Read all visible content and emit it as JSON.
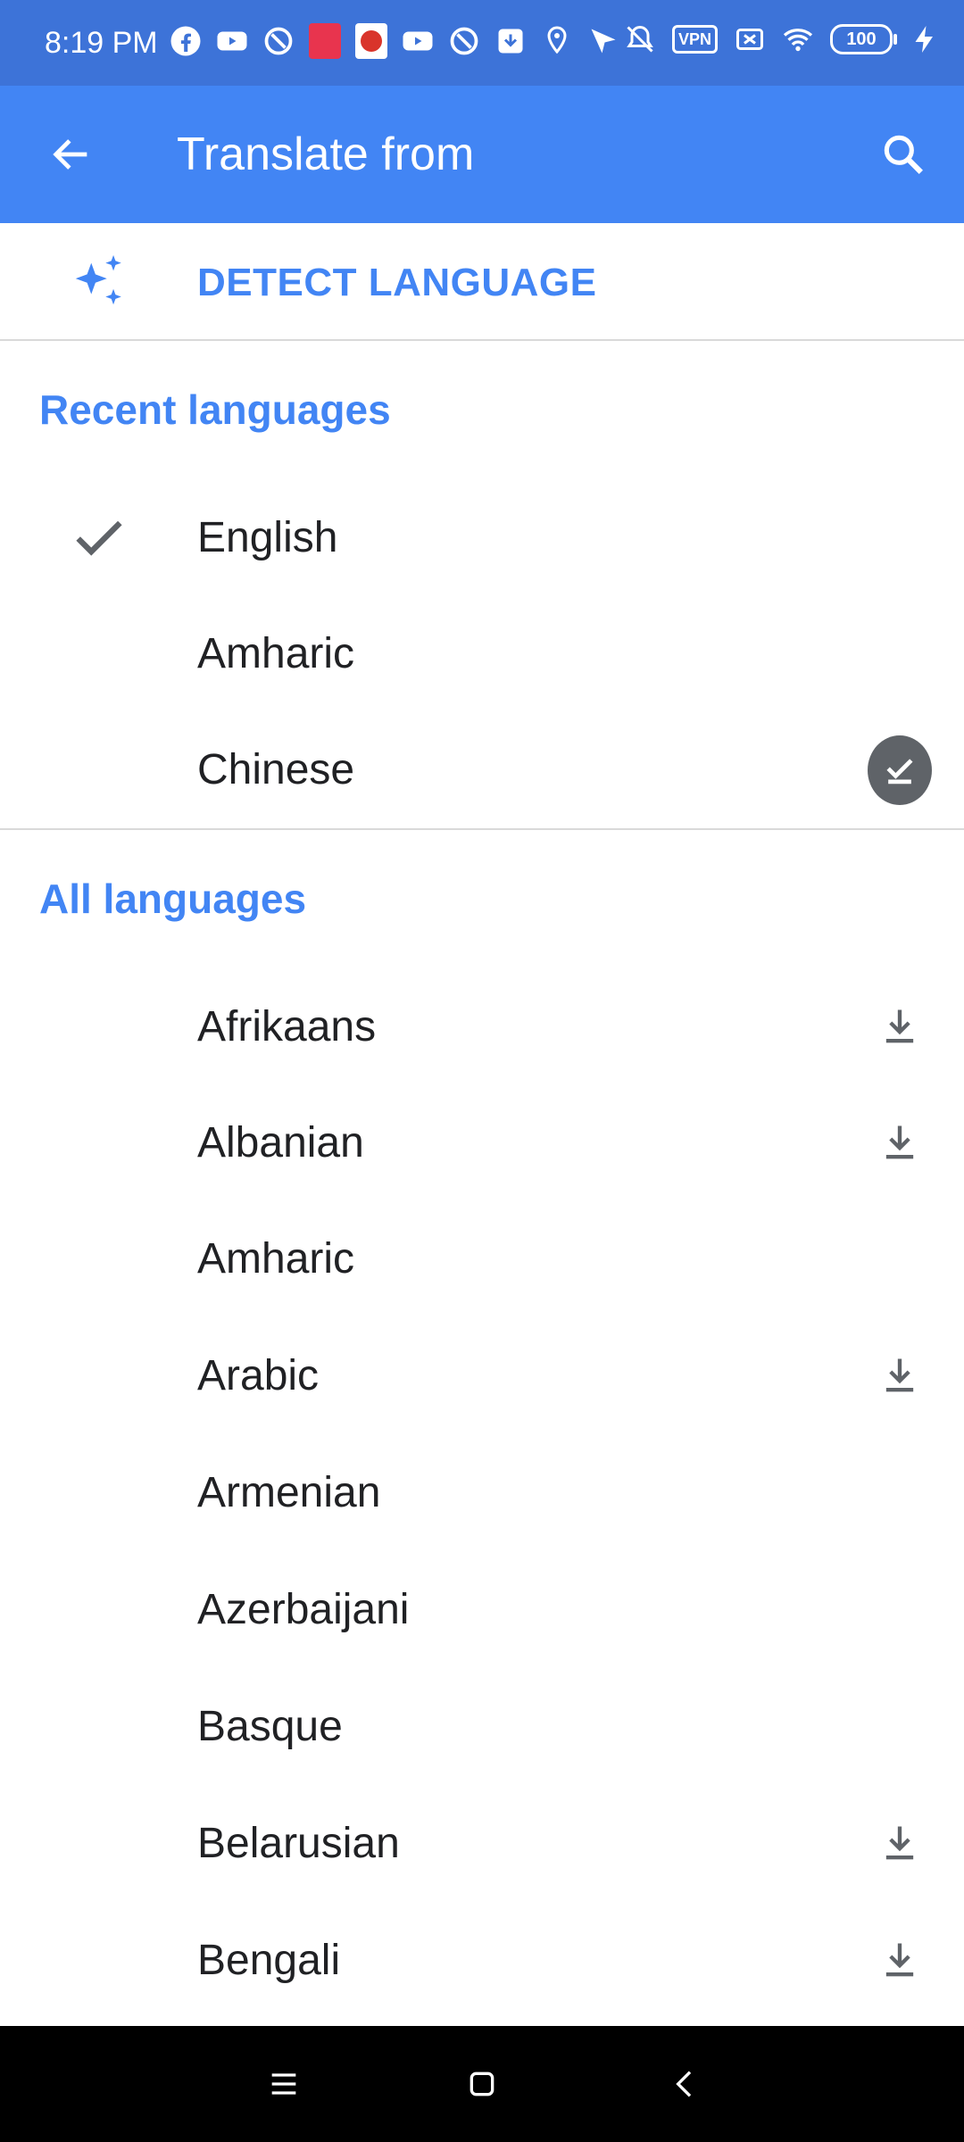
{
  "status_bar": {
    "time": "8:19 PM",
    "vpn": "VPN",
    "battery": "100",
    "left_icons": [
      "facebook-icon",
      "youtube-icon",
      "app-icon",
      "app-badge-red",
      "app-badge-red-2",
      "youtube-icon",
      "app-icon",
      "download-icon",
      "location-icon",
      "send-icon"
    ],
    "right_icons": [
      "bell-off-icon",
      "vpn-icon",
      "sim-off-icon",
      "wifi-icon",
      "battery-icon",
      "charging-icon"
    ]
  },
  "app_bar": {
    "title": "Translate from",
    "back_icon": "arrow-back-icon",
    "search_icon": "search-icon",
    "color": "#4285f4"
  },
  "detect": {
    "label": "DETECT LANGUAGE",
    "icon": "sparkle-icon"
  },
  "recent": {
    "header": "Recent languages",
    "items": [
      {
        "label": "English",
        "selected": true
      },
      {
        "label": "Amharic"
      },
      {
        "label": "Chinese",
        "offline_downloaded": true
      }
    ]
  },
  "all": {
    "header": "All languages",
    "items": [
      {
        "label": "Afrikaans",
        "download": true
      },
      {
        "label": "Albanian",
        "download": true
      },
      {
        "label": "Amharic",
        "download": false
      },
      {
        "label": "Arabic",
        "download": true
      },
      {
        "label": "Armenian",
        "download": false
      },
      {
        "label": "Azerbaijani",
        "download": false
      },
      {
        "label": "Basque",
        "download": false
      },
      {
        "label": "Belarusian",
        "download": true
      },
      {
        "label": "Bengali",
        "download": true
      }
    ]
  },
  "nav_bar": {
    "buttons": [
      "menu-icon",
      "home-icon",
      "back-icon"
    ]
  }
}
